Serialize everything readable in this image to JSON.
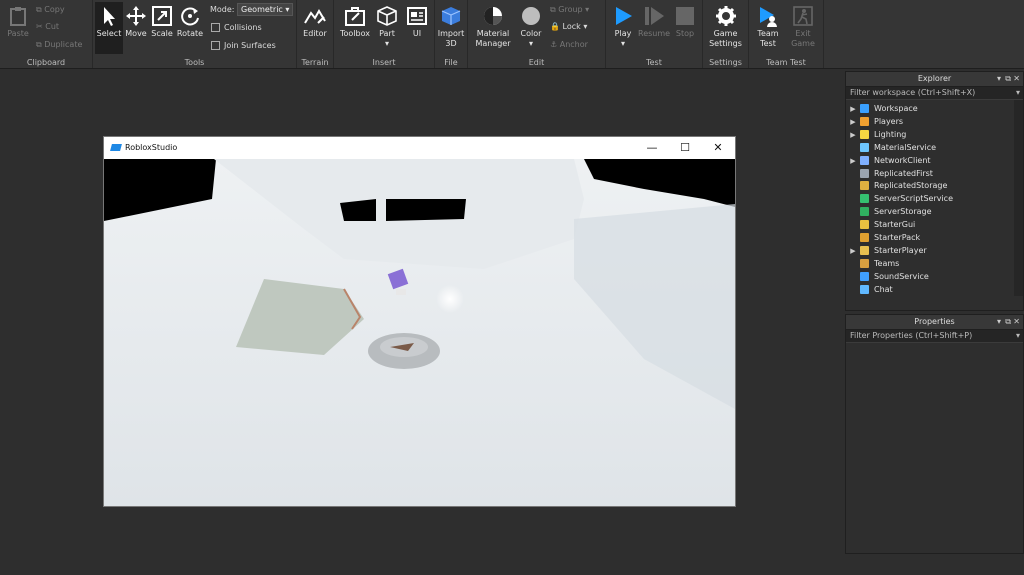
{
  "ribbon": {
    "clipboard": {
      "label": "Clipboard",
      "paste": "Paste",
      "copy": "Copy",
      "cut": "Cut",
      "duplicate": "Duplicate"
    },
    "tools": {
      "label": "Tools",
      "select": "Select",
      "move": "Move",
      "scale": "Scale",
      "rotate": "Rotate",
      "mode_label": "Mode:",
      "mode_value": "Geometric",
      "collisions": "Collisions",
      "join_surfaces": "Join Surfaces"
    },
    "terrain": {
      "label": "Terrain",
      "editor": "Editor"
    },
    "insert": {
      "label": "Insert",
      "toolbox": "Toolbox",
      "part": "Part",
      "ui": "UI"
    },
    "file": {
      "label": "File",
      "import3d_l1": "Import",
      "import3d_l2": "3D"
    },
    "edit": {
      "label": "Edit",
      "material_l1": "Material",
      "material_l2": "Manager",
      "color": "Color",
      "group": "Group",
      "lock": "Lock",
      "anchor": "Anchor"
    },
    "test": {
      "label": "Test",
      "play": "Play",
      "resume": "Resume",
      "stop": "Stop"
    },
    "settings": {
      "label": "Settings",
      "game_l1": "Game",
      "game_l2": "Settings"
    },
    "teamtest": {
      "label": "Team Test",
      "team_l1": "Team",
      "team_l2": "Test",
      "exit_l1": "Exit",
      "exit_l2": "Game"
    }
  },
  "window": {
    "title": "RobloxStudio",
    "minimize": "—",
    "maximize": "☐",
    "close": "✕"
  },
  "explorer": {
    "title": "Explorer",
    "filter": "Filter workspace (Ctrl+Shift+X)",
    "items": [
      {
        "label": "Workspace",
        "color": "#3aa0ff",
        "arrow": "▶"
      },
      {
        "label": "Players",
        "color": "#f0a030",
        "arrow": "▶"
      },
      {
        "label": "Lighting",
        "color": "#f5d742",
        "arrow": "▶"
      },
      {
        "label": "MaterialService",
        "color": "#6ec6ff",
        "arrow": ""
      },
      {
        "label": "NetworkClient",
        "color": "#7fb0ff",
        "arrow": "▶"
      },
      {
        "label": "ReplicatedFirst",
        "color": "#9aa4b0",
        "arrow": ""
      },
      {
        "label": "ReplicatedStorage",
        "color": "#e0b040",
        "arrow": ""
      },
      {
        "label": "ServerScriptService",
        "color": "#35c070",
        "arrow": ""
      },
      {
        "label": "ServerStorage",
        "color": "#30b060",
        "arrow": ""
      },
      {
        "label": "StarterGui",
        "color": "#e8c040",
        "arrow": ""
      },
      {
        "label": "StarterPack",
        "color": "#e0a030",
        "arrow": ""
      },
      {
        "label": "StarterPlayer",
        "color": "#e8c050",
        "arrow": "▶"
      },
      {
        "label": "Teams",
        "color": "#d8a040",
        "arrow": ""
      },
      {
        "label": "SoundService",
        "color": "#40a0ff",
        "arrow": ""
      },
      {
        "label": "Chat",
        "color": "#60b8ff",
        "arrow": ""
      }
    ]
  },
  "properties": {
    "title": "Properties",
    "filter": "Filter Properties (Ctrl+Shift+P)"
  }
}
